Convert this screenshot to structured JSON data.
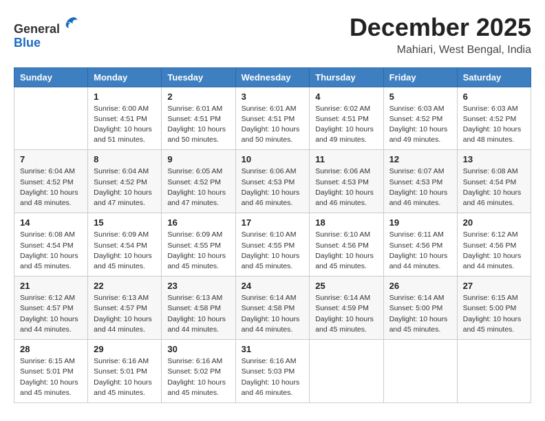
{
  "logo": {
    "general": "General",
    "blue": "Blue"
  },
  "title": {
    "month": "December 2025",
    "location": "Mahiari, West Bengal, India"
  },
  "headers": [
    "Sunday",
    "Monday",
    "Tuesday",
    "Wednesday",
    "Thursday",
    "Friday",
    "Saturday"
  ],
  "weeks": [
    [
      {
        "day": "",
        "info": ""
      },
      {
        "day": "1",
        "info": "Sunrise: 6:00 AM\nSunset: 4:51 PM\nDaylight: 10 hours\nand 51 minutes."
      },
      {
        "day": "2",
        "info": "Sunrise: 6:01 AM\nSunset: 4:51 PM\nDaylight: 10 hours\nand 50 minutes."
      },
      {
        "day": "3",
        "info": "Sunrise: 6:01 AM\nSunset: 4:51 PM\nDaylight: 10 hours\nand 50 minutes."
      },
      {
        "day": "4",
        "info": "Sunrise: 6:02 AM\nSunset: 4:51 PM\nDaylight: 10 hours\nand 49 minutes."
      },
      {
        "day": "5",
        "info": "Sunrise: 6:03 AM\nSunset: 4:52 PM\nDaylight: 10 hours\nand 49 minutes."
      },
      {
        "day": "6",
        "info": "Sunrise: 6:03 AM\nSunset: 4:52 PM\nDaylight: 10 hours\nand 48 minutes."
      }
    ],
    [
      {
        "day": "7",
        "info": "Sunrise: 6:04 AM\nSunset: 4:52 PM\nDaylight: 10 hours\nand 48 minutes."
      },
      {
        "day": "8",
        "info": "Sunrise: 6:04 AM\nSunset: 4:52 PM\nDaylight: 10 hours\nand 47 minutes."
      },
      {
        "day": "9",
        "info": "Sunrise: 6:05 AM\nSunset: 4:52 PM\nDaylight: 10 hours\nand 47 minutes."
      },
      {
        "day": "10",
        "info": "Sunrise: 6:06 AM\nSunset: 4:53 PM\nDaylight: 10 hours\nand 46 minutes."
      },
      {
        "day": "11",
        "info": "Sunrise: 6:06 AM\nSunset: 4:53 PM\nDaylight: 10 hours\nand 46 minutes."
      },
      {
        "day": "12",
        "info": "Sunrise: 6:07 AM\nSunset: 4:53 PM\nDaylight: 10 hours\nand 46 minutes."
      },
      {
        "day": "13",
        "info": "Sunrise: 6:08 AM\nSunset: 4:54 PM\nDaylight: 10 hours\nand 46 minutes."
      }
    ],
    [
      {
        "day": "14",
        "info": "Sunrise: 6:08 AM\nSunset: 4:54 PM\nDaylight: 10 hours\nand 45 minutes."
      },
      {
        "day": "15",
        "info": "Sunrise: 6:09 AM\nSunset: 4:54 PM\nDaylight: 10 hours\nand 45 minutes."
      },
      {
        "day": "16",
        "info": "Sunrise: 6:09 AM\nSunset: 4:55 PM\nDaylight: 10 hours\nand 45 minutes."
      },
      {
        "day": "17",
        "info": "Sunrise: 6:10 AM\nSunset: 4:55 PM\nDaylight: 10 hours\nand 45 minutes."
      },
      {
        "day": "18",
        "info": "Sunrise: 6:10 AM\nSunset: 4:56 PM\nDaylight: 10 hours\nand 45 minutes."
      },
      {
        "day": "19",
        "info": "Sunrise: 6:11 AM\nSunset: 4:56 PM\nDaylight: 10 hours\nand 44 minutes."
      },
      {
        "day": "20",
        "info": "Sunrise: 6:12 AM\nSunset: 4:56 PM\nDaylight: 10 hours\nand 44 minutes."
      }
    ],
    [
      {
        "day": "21",
        "info": "Sunrise: 6:12 AM\nSunset: 4:57 PM\nDaylight: 10 hours\nand 44 minutes."
      },
      {
        "day": "22",
        "info": "Sunrise: 6:13 AM\nSunset: 4:57 PM\nDaylight: 10 hours\nand 44 minutes."
      },
      {
        "day": "23",
        "info": "Sunrise: 6:13 AM\nSunset: 4:58 PM\nDaylight: 10 hours\nand 44 minutes."
      },
      {
        "day": "24",
        "info": "Sunrise: 6:14 AM\nSunset: 4:58 PM\nDaylight: 10 hours\nand 44 minutes."
      },
      {
        "day": "25",
        "info": "Sunrise: 6:14 AM\nSunset: 4:59 PM\nDaylight: 10 hours\nand 45 minutes."
      },
      {
        "day": "26",
        "info": "Sunrise: 6:14 AM\nSunset: 5:00 PM\nDaylight: 10 hours\nand 45 minutes."
      },
      {
        "day": "27",
        "info": "Sunrise: 6:15 AM\nSunset: 5:00 PM\nDaylight: 10 hours\nand 45 minutes."
      }
    ],
    [
      {
        "day": "28",
        "info": "Sunrise: 6:15 AM\nSunset: 5:01 PM\nDaylight: 10 hours\nand 45 minutes."
      },
      {
        "day": "29",
        "info": "Sunrise: 6:16 AM\nSunset: 5:01 PM\nDaylight: 10 hours\nand 45 minutes."
      },
      {
        "day": "30",
        "info": "Sunrise: 6:16 AM\nSunset: 5:02 PM\nDaylight: 10 hours\nand 45 minutes."
      },
      {
        "day": "31",
        "info": "Sunrise: 6:16 AM\nSunset: 5:03 PM\nDaylight: 10 hours\nand 46 minutes."
      },
      {
        "day": "",
        "info": ""
      },
      {
        "day": "",
        "info": ""
      },
      {
        "day": "",
        "info": ""
      }
    ]
  ]
}
